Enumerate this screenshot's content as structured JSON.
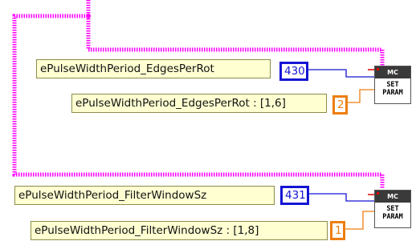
{
  "blocks": [
    {
      "param_name": "ePulseWidthPeriod_EdgesPerRot",
      "param_value": "430",
      "range_label": "ePulseWidthPeriod_EdgesPerRot : [1,6]",
      "range_value": "2",
      "vi_header": "MC",
      "vi_line1": "SET",
      "vi_line2": "PARAM"
    },
    {
      "param_name": "ePulseWidthPeriod_FilterWindowSz",
      "param_value": "431",
      "range_label": "ePulseWidthPeriod_FilterWindowSz : [1,8]",
      "range_value": "1",
      "vi_header": "MC",
      "vi_line1": "SET",
      "vi_line2": "PARAM"
    }
  ],
  "colors": {
    "refnum_wire": "#ff00ff",
    "i32_wire": "#1414d4",
    "u16_wire": "#ee7d10",
    "error_wire": "#e00000",
    "constant_bg": "#ffffd2"
  }
}
